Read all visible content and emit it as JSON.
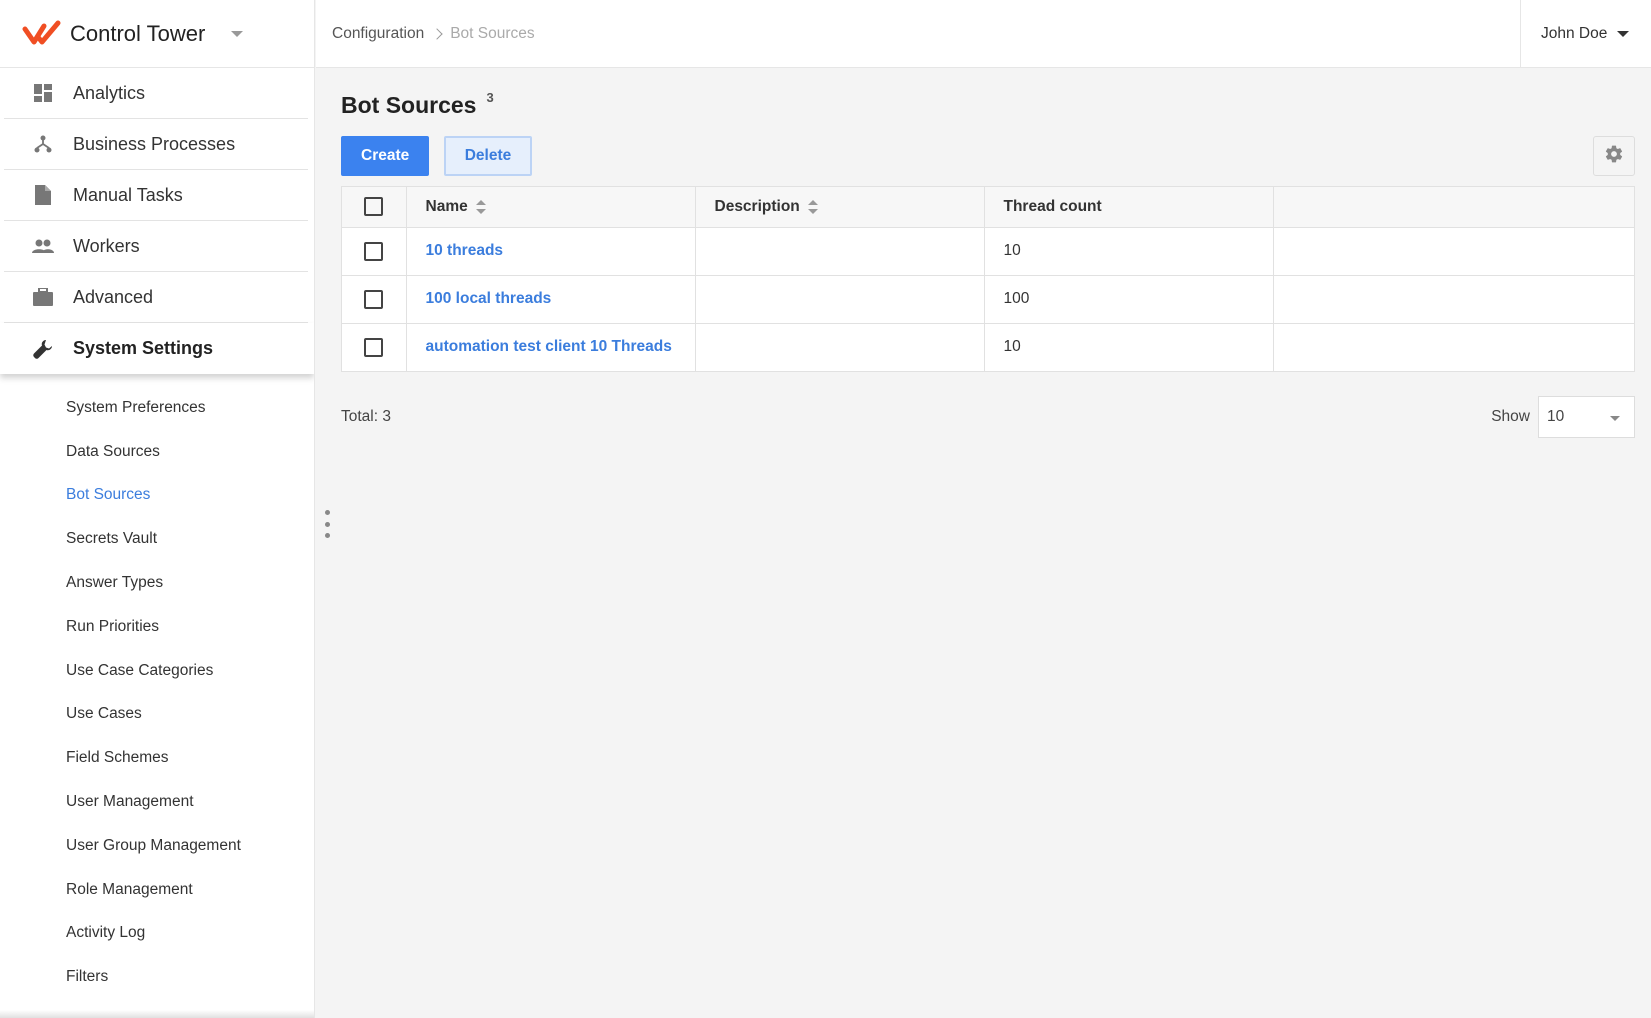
{
  "app": {
    "title": "Control Tower",
    "accent_color": "#3b82ef",
    "logo_color": "#f04e23"
  },
  "sidebar": {
    "nav": [
      {
        "label": "Analytics",
        "icon": "dashboard-icon"
      },
      {
        "label": "Business Processes",
        "icon": "process-tree-icon"
      },
      {
        "label": "Manual Tasks",
        "icon": "document-icon"
      },
      {
        "label": "Workers",
        "icon": "people-icon"
      },
      {
        "label": "Advanced",
        "icon": "briefcase-icon"
      },
      {
        "label": "System Settings",
        "icon": "wrench-icon",
        "active": true
      }
    ],
    "subnav": [
      {
        "label": "System Preferences"
      },
      {
        "label": "Data Sources"
      },
      {
        "label": "Bot Sources",
        "active": true
      },
      {
        "label": "Secrets Vault"
      },
      {
        "label": "Answer Types"
      },
      {
        "label": "Run Priorities"
      },
      {
        "label": "Use Case Categories"
      },
      {
        "label": "Use Cases"
      },
      {
        "label": "Field Schemes"
      },
      {
        "label": "User Management"
      },
      {
        "label": "User Group Management"
      },
      {
        "label": "Role Management"
      },
      {
        "label": "Activity Log"
      },
      {
        "label": "Filters"
      }
    ]
  },
  "header": {
    "breadcrumb": [
      "Configuration",
      "Bot Sources"
    ],
    "user_name": "John Doe"
  },
  "page": {
    "title": "Bot Sources",
    "count": "3",
    "create_label": "Create",
    "delete_label": "Delete"
  },
  "table": {
    "columns": [
      "Name",
      "Description",
      "Thread count"
    ],
    "rows": [
      {
        "name": "10 threads",
        "description": "",
        "thread_count": "10"
      },
      {
        "name": "100 local threads",
        "description": "",
        "thread_count": "100"
      },
      {
        "name": "automation test client 10 Threads",
        "description": "",
        "thread_count": "10"
      }
    ]
  },
  "footer": {
    "total": "Total: 3",
    "show_label": "Show",
    "page_size": "10"
  }
}
